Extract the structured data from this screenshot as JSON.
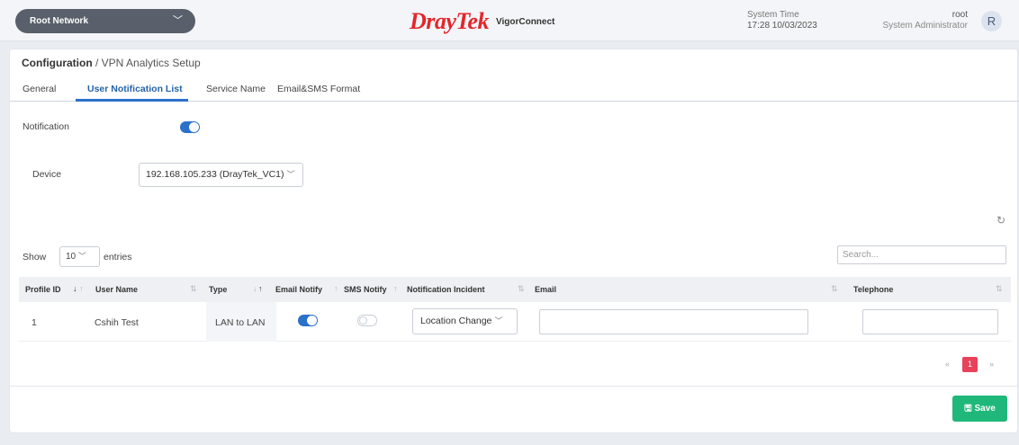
{
  "header": {
    "network_select": "Root Network",
    "logo_brand": "DrayTek",
    "logo_product": "VigorConnect",
    "system_time_label": "System Time",
    "system_time_value": "17:28 10/03/2023",
    "user_name": "root",
    "user_role": "System Administrator",
    "avatar_letter": "R"
  },
  "breadcrumb": {
    "section": "Configuration",
    "separator": " / ",
    "page": "VPN Analytics Setup"
  },
  "tabs": [
    {
      "label": "General"
    },
    {
      "label": "User Notification List",
      "active": true
    },
    {
      "label": "Service Name"
    },
    {
      "label": "Email&SMS Format"
    }
  ],
  "form": {
    "notification_label": "Notification",
    "notification_on": true,
    "device_label": "Device",
    "device_value": "192.168.105.233 (DrayTek_VC1)"
  },
  "table_controls": {
    "show_label": "Show",
    "entries_value": "10",
    "entries_label": "entries",
    "search_placeholder": "Search..."
  },
  "table": {
    "columns": [
      "Profile ID",
      "User Name",
      "Type",
      "Email Notify",
      "SMS Notify",
      "Notification Incident",
      "Email",
      "Telephone"
    ],
    "rows": [
      {
        "profile_id": "1",
        "user_name": "Cshih Test",
        "type": "LAN to LAN",
        "email_notify": true,
        "sms_notify": false,
        "incident": "Location Change",
        "email": "",
        "telephone": ""
      }
    ]
  },
  "pagination": {
    "first": "«",
    "current": "1",
    "last": "»"
  },
  "actions": {
    "save_label": "Save"
  },
  "colors": {
    "accent": "#2b70c9",
    "save": "#1fb87a",
    "brand": "#e3262a",
    "page_active": "#e8425a"
  }
}
